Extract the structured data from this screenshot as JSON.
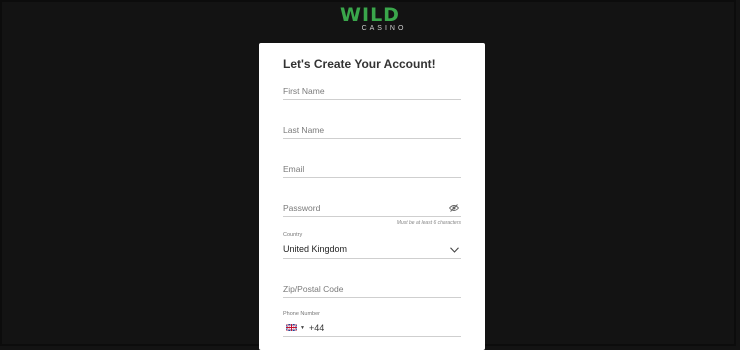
{
  "brand": {
    "name": "WILD",
    "sub": "CASINO",
    "accent": "#3aa64b"
  },
  "form": {
    "title": "Let's Create Your Account!",
    "first_name": {
      "placeholder": "First Name"
    },
    "last_name": {
      "placeholder": "Last Name"
    },
    "email": {
      "placeholder": "Email"
    },
    "password": {
      "placeholder": "Password",
      "hint": "Must be at least 6 characters",
      "icon": "eye-icon"
    },
    "country": {
      "label": "Country",
      "value": "United Kingdom",
      "icon": "chevron-down-icon"
    },
    "zip": {
      "placeholder": "Zip/Postal Code"
    },
    "phone": {
      "label": "Phone Number",
      "code": "+44",
      "flag": "uk-flag-icon"
    }
  },
  "colors": {
    "background": "#131313",
    "card": "#ffffff",
    "underline": "#cfcfcf"
  }
}
